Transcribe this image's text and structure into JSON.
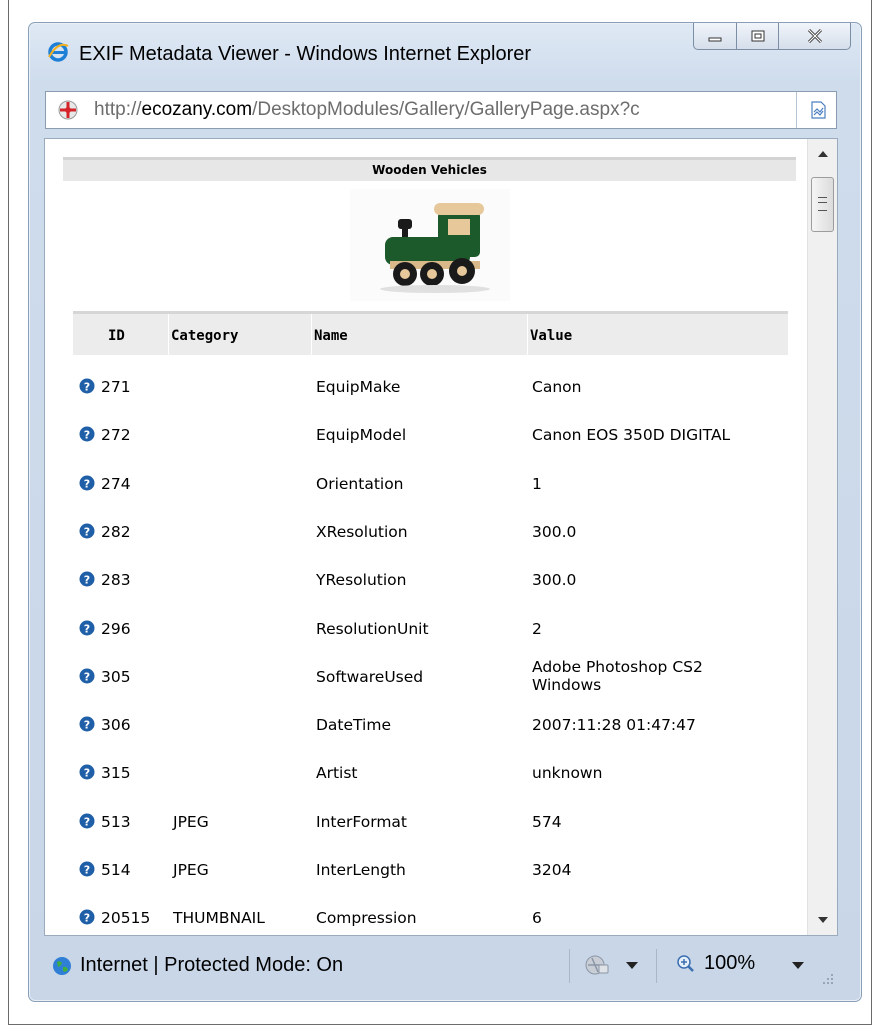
{
  "window": {
    "title": "EXIF Metadata Viewer - Windows Internet Explorer"
  },
  "address": {
    "prefix": "http://",
    "domain": "ecozany.com",
    "path": "/DesktopModules/Gallery/GalleryPage.aspx?c"
  },
  "gallery": {
    "title": "Wooden Vehicles",
    "image_alt": "wooden toy train"
  },
  "table": {
    "headers": [
      "ID",
      "Category",
      "Name",
      "Value"
    ],
    "rows": [
      {
        "id": "271",
        "category": "",
        "name": "EquipMake",
        "value": "Canon",
        "value2": ""
      },
      {
        "id": "272",
        "category": "",
        "name": "EquipModel",
        "value": "Canon EOS 350D DIGITAL",
        "value2": ""
      },
      {
        "id": "274",
        "category": "",
        "name": "Orientation",
        "value": "1",
        "value2": ""
      },
      {
        "id": "282",
        "category": "",
        "name": "XResolution",
        "value": "300.0",
        "value2": ""
      },
      {
        "id": "283",
        "category": "",
        "name": "YResolution",
        "value": "300.0",
        "value2": ""
      },
      {
        "id": "296",
        "category": "",
        "name": "ResolutionUnit",
        "value": "2",
        "value2": ""
      },
      {
        "id": "305",
        "category": "",
        "name": "SoftwareUsed",
        "value": "Adobe Photoshop CS2",
        "value2": "Windows"
      },
      {
        "id": "306",
        "category": "",
        "name": "DateTime",
        "value": "2007:11:28 01:47:47",
        "value2": ""
      },
      {
        "id": "315",
        "category": "",
        "name": "Artist",
        "value": "unknown",
        "value2": ""
      },
      {
        "id": "513",
        "category": "JPEG",
        "name": "InterFormat",
        "value": "574",
        "value2": ""
      },
      {
        "id": "514",
        "category": "JPEG",
        "name": "InterLength",
        "value": "3204",
        "value2": ""
      },
      {
        "id": "20515",
        "category": "THUMBNAIL",
        "name": "Compression",
        "value": "6",
        "value2": ""
      }
    ]
  },
  "status": {
    "zone": "Internet | Protected Mode: On",
    "zoom": "100%"
  },
  "colors": {
    "help_icon": "#1f5fa8",
    "window_frame": "#c8d6e8"
  },
  "icons": [
    "ie-logo-icon",
    "minimize-icon",
    "maximize-icon",
    "close-icon",
    "site-icon",
    "compatibility-view-icon",
    "help-icon",
    "globe-icon",
    "security-icon",
    "zoom-icon"
  ]
}
